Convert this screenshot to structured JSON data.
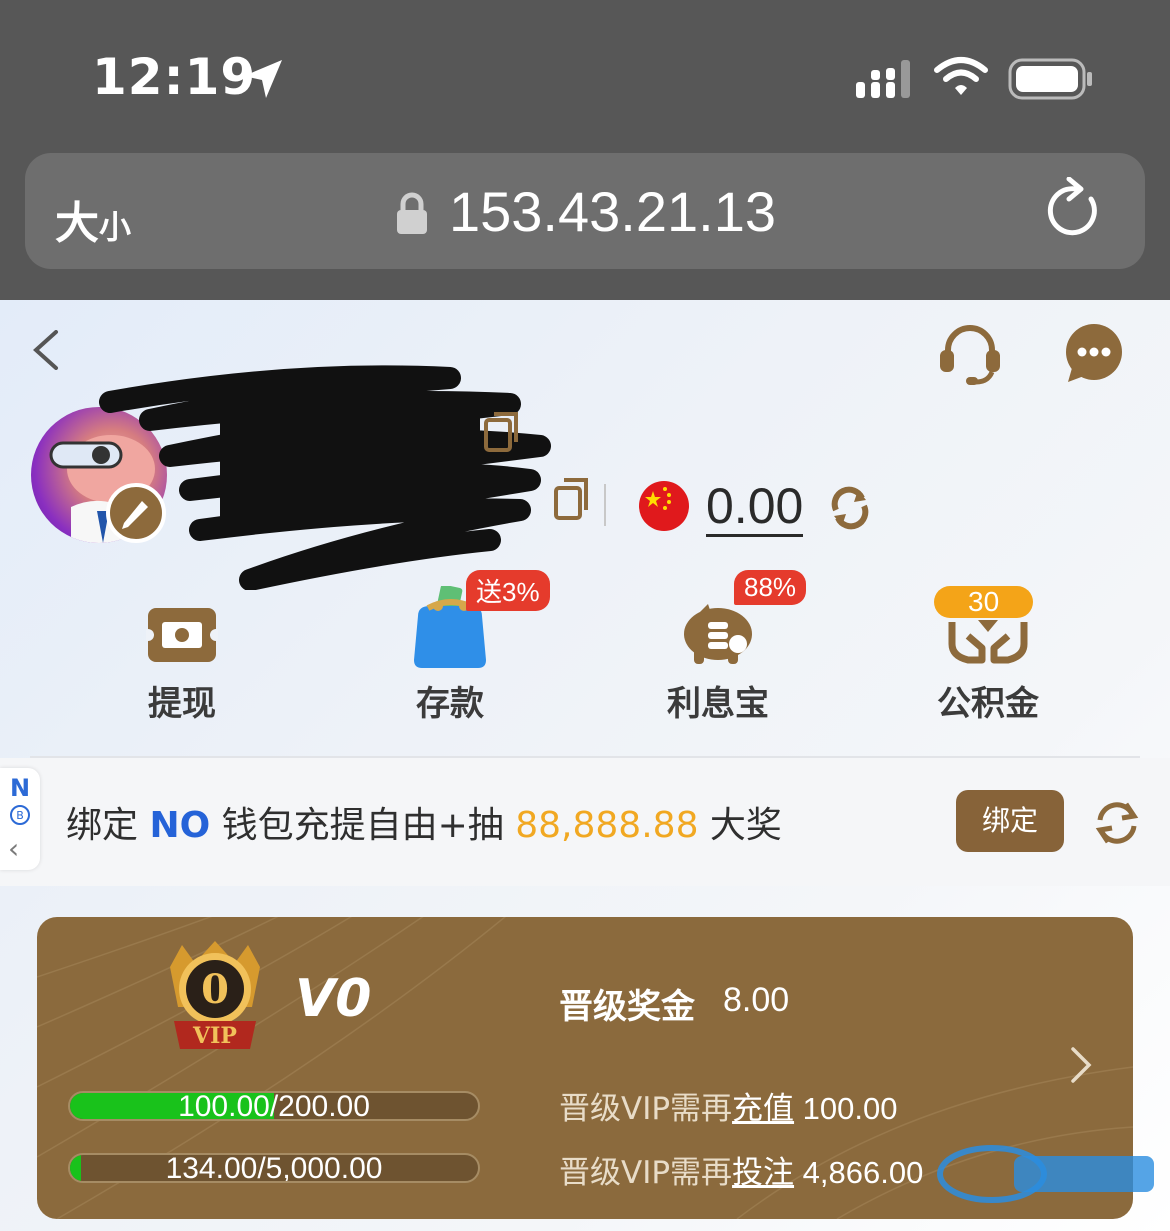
{
  "status_bar": {
    "time": "12:19"
  },
  "browser": {
    "text_size_big": "大",
    "text_size_small": "小",
    "url": "153.43.21.13"
  },
  "profile": {
    "balance": "0.00",
    "currency_flag": "china-flag-icon"
  },
  "quick_actions": [
    {
      "label": "提现",
      "icon": "withdraw-icon"
    },
    {
      "label": "存款",
      "icon": "wallet-icon",
      "badge": "送3%"
    },
    {
      "label": "利息宝",
      "icon": "piggy-bank-icon",
      "badge": "88%"
    },
    {
      "label": "公积金",
      "icon": "hands-coin-icon",
      "badge": "30"
    }
  ],
  "bind_banner": {
    "side_tab_letter": "N",
    "prefix": "绑定 ",
    "brand": "NO",
    "middle": " 钱包充提自由+抽 ",
    "amount": "88,888.88",
    "suffix": " 大奖",
    "button": "绑定"
  },
  "vip": {
    "emblem_number": "0",
    "emblem_text": "VIP",
    "level": "V0",
    "promo_label": "晋级奖金",
    "promo_value": "8.00",
    "deposit_progress": {
      "text": "100.00/200.00",
      "fraction": 0.5
    },
    "bet_progress": {
      "text": "134.00/5,000.00",
      "fraction": 0.0268
    },
    "need_deposit": {
      "prefix": "晋级VIP需再",
      "link": "充值",
      "value": " 100.00"
    },
    "need_bet": {
      "prefix": "晋级VIP需再",
      "link": "投注",
      "value": " 4,866.00"
    }
  },
  "colors": {
    "brand_brown": "#876339",
    "card_brown": "#8b6a3d",
    "progress_green": "#19c21b",
    "badge_red": "#e53b2c",
    "badge_orange": "#f4a418",
    "amount_gold": "#f1a822"
  }
}
